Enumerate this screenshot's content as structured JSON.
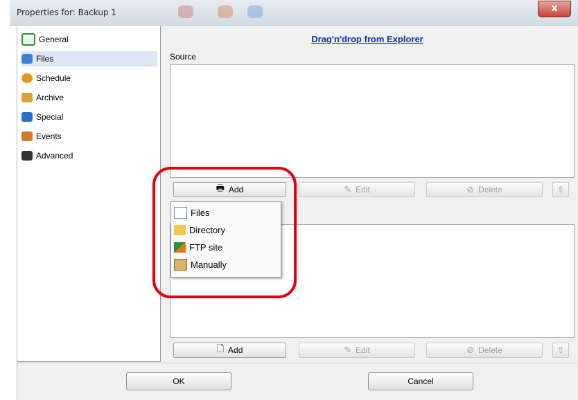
{
  "window": {
    "title": "Properties for: Backup 1",
    "close_label": "x"
  },
  "sidebar": {
    "items": [
      {
        "label": "General",
        "icon": "general-icon",
        "color": "#3a8a3a"
      },
      {
        "label": "Files",
        "icon": "files-icon",
        "color": "#3d7fd4",
        "selected": true
      },
      {
        "label": "Schedule",
        "icon": "schedule-icon",
        "color": "#e29b1d"
      },
      {
        "label": "Archive",
        "icon": "archive-icon",
        "color": "#d8a33a"
      },
      {
        "label": "Special",
        "icon": "special-icon",
        "color": "#2f6fd0"
      },
      {
        "label": "Events",
        "icon": "events-icon",
        "color": "#d07a2a"
      },
      {
        "label": "Advanced",
        "icon": "advanced-icon",
        "color": "#333333"
      }
    ]
  },
  "main": {
    "drag_link": "Drag'n'drop from Explorer",
    "source_label": "Source",
    "source_buttons": {
      "add": "Add",
      "edit": "Edit",
      "delete": "Delete"
    },
    "dest_buttons": {
      "add": "Add",
      "edit": "Edit",
      "delete": "Delete"
    }
  },
  "add_menu": {
    "items": [
      {
        "label": "Files",
        "icon": "file-icon"
      },
      {
        "label": "Directory",
        "icon": "folder-icon"
      },
      {
        "label": "FTP site",
        "icon": "ftp-icon"
      },
      {
        "label": "Manually",
        "icon": "clipboard-icon"
      }
    ]
  },
  "footer": {
    "ok": "OK",
    "cancel": "Cancel"
  },
  "colors": {
    "callout": "#e0000f",
    "link": "#0a2db5",
    "selected": "#dde6f4"
  }
}
